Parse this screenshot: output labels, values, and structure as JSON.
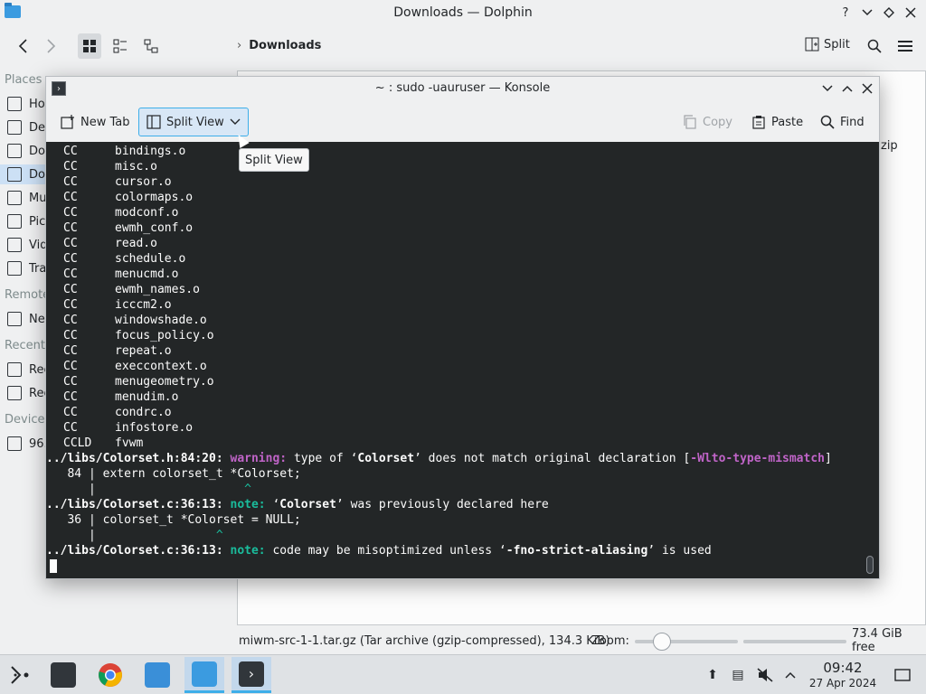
{
  "dolphin": {
    "title": "Downloads — Dolphin",
    "breadcrumb": "Downloads",
    "split_label": "Split",
    "places_sections": {
      "places": "Places",
      "remote": "Remote",
      "recent": "Recent",
      "devices": "Devices"
    },
    "places_items": [
      "Ho",
      "De",
      "Do",
      "Do",
      "Mu",
      "Pic",
      "Vid",
      "Tra"
    ],
    "remote_items": [
      "Ne"
    ],
    "recent_items": [
      "Rec",
      "Rec"
    ],
    "devices_items": [
      "96."
    ],
    "zip_fragment": "zip",
    "status_file": "miwm-src-1-1.tar.gz (Tar archive (gzip-compressed), 134.3 KiB)",
    "zoom_label": "Zoom:",
    "free_space": "73.4 GiB free"
  },
  "konsole": {
    "title": "~ : sudo -uauruser — Konsole",
    "toolbar": {
      "new_tab": "New Tab",
      "split_view": "Split View",
      "copy": "Copy",
      "paste": "Paste",
      "find": "Find"
    },
    "tooltip": "Split View",
    "compile_lines": [
      {
        "tag": "CC",
        "file": "bindings.o"
      },
      {
        "tag": "CC",
        "file": "misc.o"
      },
      {
        "tag": "CC",
        "file": "cursor.o"
      },
      {
        "tag": "CC",
        "file": "colormaps.o"
      },
      {
        "tag": "CC",
        "file": "modconf.o"
      },
      {
        "tag": "CC",
        "file": "ewmh_conf.o"
      },
      {
        "tag": "CC",
        "file": "read.o"
      },
      {
        "tag": "CC",
        "file": "schedule.o"
      },
      {
        "tag": "CC",
        "file": "menucmd.o"
      },
      {
        "tag": "CC",
        "file": "ewmh_names.o"
      },
      {
        "tag": "CC",
        "file": "icccm2.o"
      },
      {
        "tag": "CC",
        "file": "windowshade.o"
      },
      {
        "tag": "CC",
        "file": "focus_policy.o"
      },
      {
        "tag": "CC",
        "file": "repeat.o"
      },
      {
        "tag": "CC",
        "file": "execcontext.o"
      },
      {
        "tag": "CC",
        "file": "menugeometry.o"
      },
      {
        "tag": "CC",
        "file": "menudim.o"
      },
      {
        "tag": "CC",
        "file": "condrc.o"
      },
      {
        "tag": "CC",
        "file": "infostore.o"
      },
      {
        "tag": "CCLD",
        "file": "fvwm"
      }
    ],
    "diag1": {
      "loc": "../libs/Colorset.h:84:20:",
      "kind": "warning:",
      "msg_a": " type of ‘",
      "sym": "Colorset",
      "msg_b": "’ does not match original declaration [",
      "flag": "-Wlto-type-mismatch",
      "msg_c": "]",
      "src_line": "   84 | extern colorset_t *Colorset;",
      "bar_line": "      |",
      "caret_line": "                            ^"
    },
    "diag2": {
      "loc": "../libs/Colorset.c:36:13:",
      "kind": "note:",
      "msg_a": " ‘",
      "sym": "Colorset",
      "msg_b": "’ was previously declared here",
      "src_line": "   36 | colorset_t *Colorset = NULL;",
      "bar_line": "      |",
      "caret_line": "                        ^"
    },
    "diag3": {
      "loc": "../libs/Colorset.c:36:13:",
      "kind": "note:",
      "msg_a": " code may be misoptimized unless ‘",
      "sym": "-fno-strict-aliasing",
      "msg_b": "’ is used"
    }
  },
  "taskbar": {
    "time": "09:42",
    "date": "27 Apr 2024"
  },
  "colors": {
    "terminal_bg": "#232627",
    "accent": "#3daee9",
    "warning": "#c064c8",
    "note": "#1abc9c"
  }
}
